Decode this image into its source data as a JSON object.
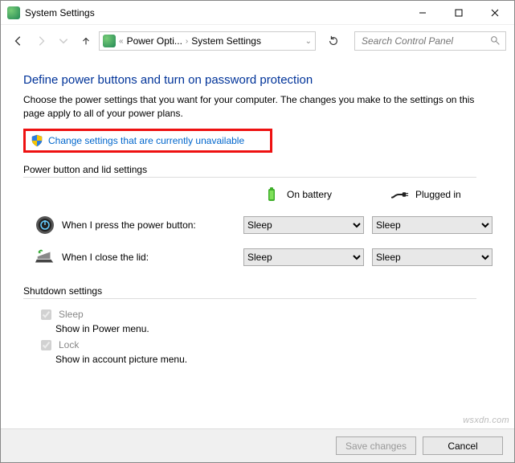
{
  "window": {
    "title": "System Settings"
  },
  "breadcrumb": {
    "item1": "Power Opti...",
    "item2": "System Settings"
  },
  "search": {
    "placeholder": "Search Control Panel"
  },
  "page": {
    "heading": "Define power buttons and turn on password protection",
    "description": "Choose the power settings that you want for your computer. The changes you make to the settings on this page apply to all of your power plans.",
    "change_link": "Change settings that are currently unavailable"
  },
  "power_section": {
    "label": "Power button and lid settings",
    "col_battery": "On battery",
    "col_plugged": "Plugged in",
    "row_power_button": "When I press the power button:",
    "row_lid": "When I close the lid:",
    "value_power_battery": "Sleep",
    "value_power_plugged": "Sleep",
    "value_lid_battery": "Sleep",
    "value_lid_plugged": "Sleep"
  },
  "shutdown_section": {
    "label": "Shutdown settings",
    "sleep_label": "Sleep",
    "sleep_desc": "Show in Power menu.",
    "lock_label": "Lock",
    "lock_desc": "Show in account picture menu."
  },
  "footer": {
    "save": "Save changes",
    "cancel": "Cancel"
  },
  "watermark": "wsxdn.com"
}
